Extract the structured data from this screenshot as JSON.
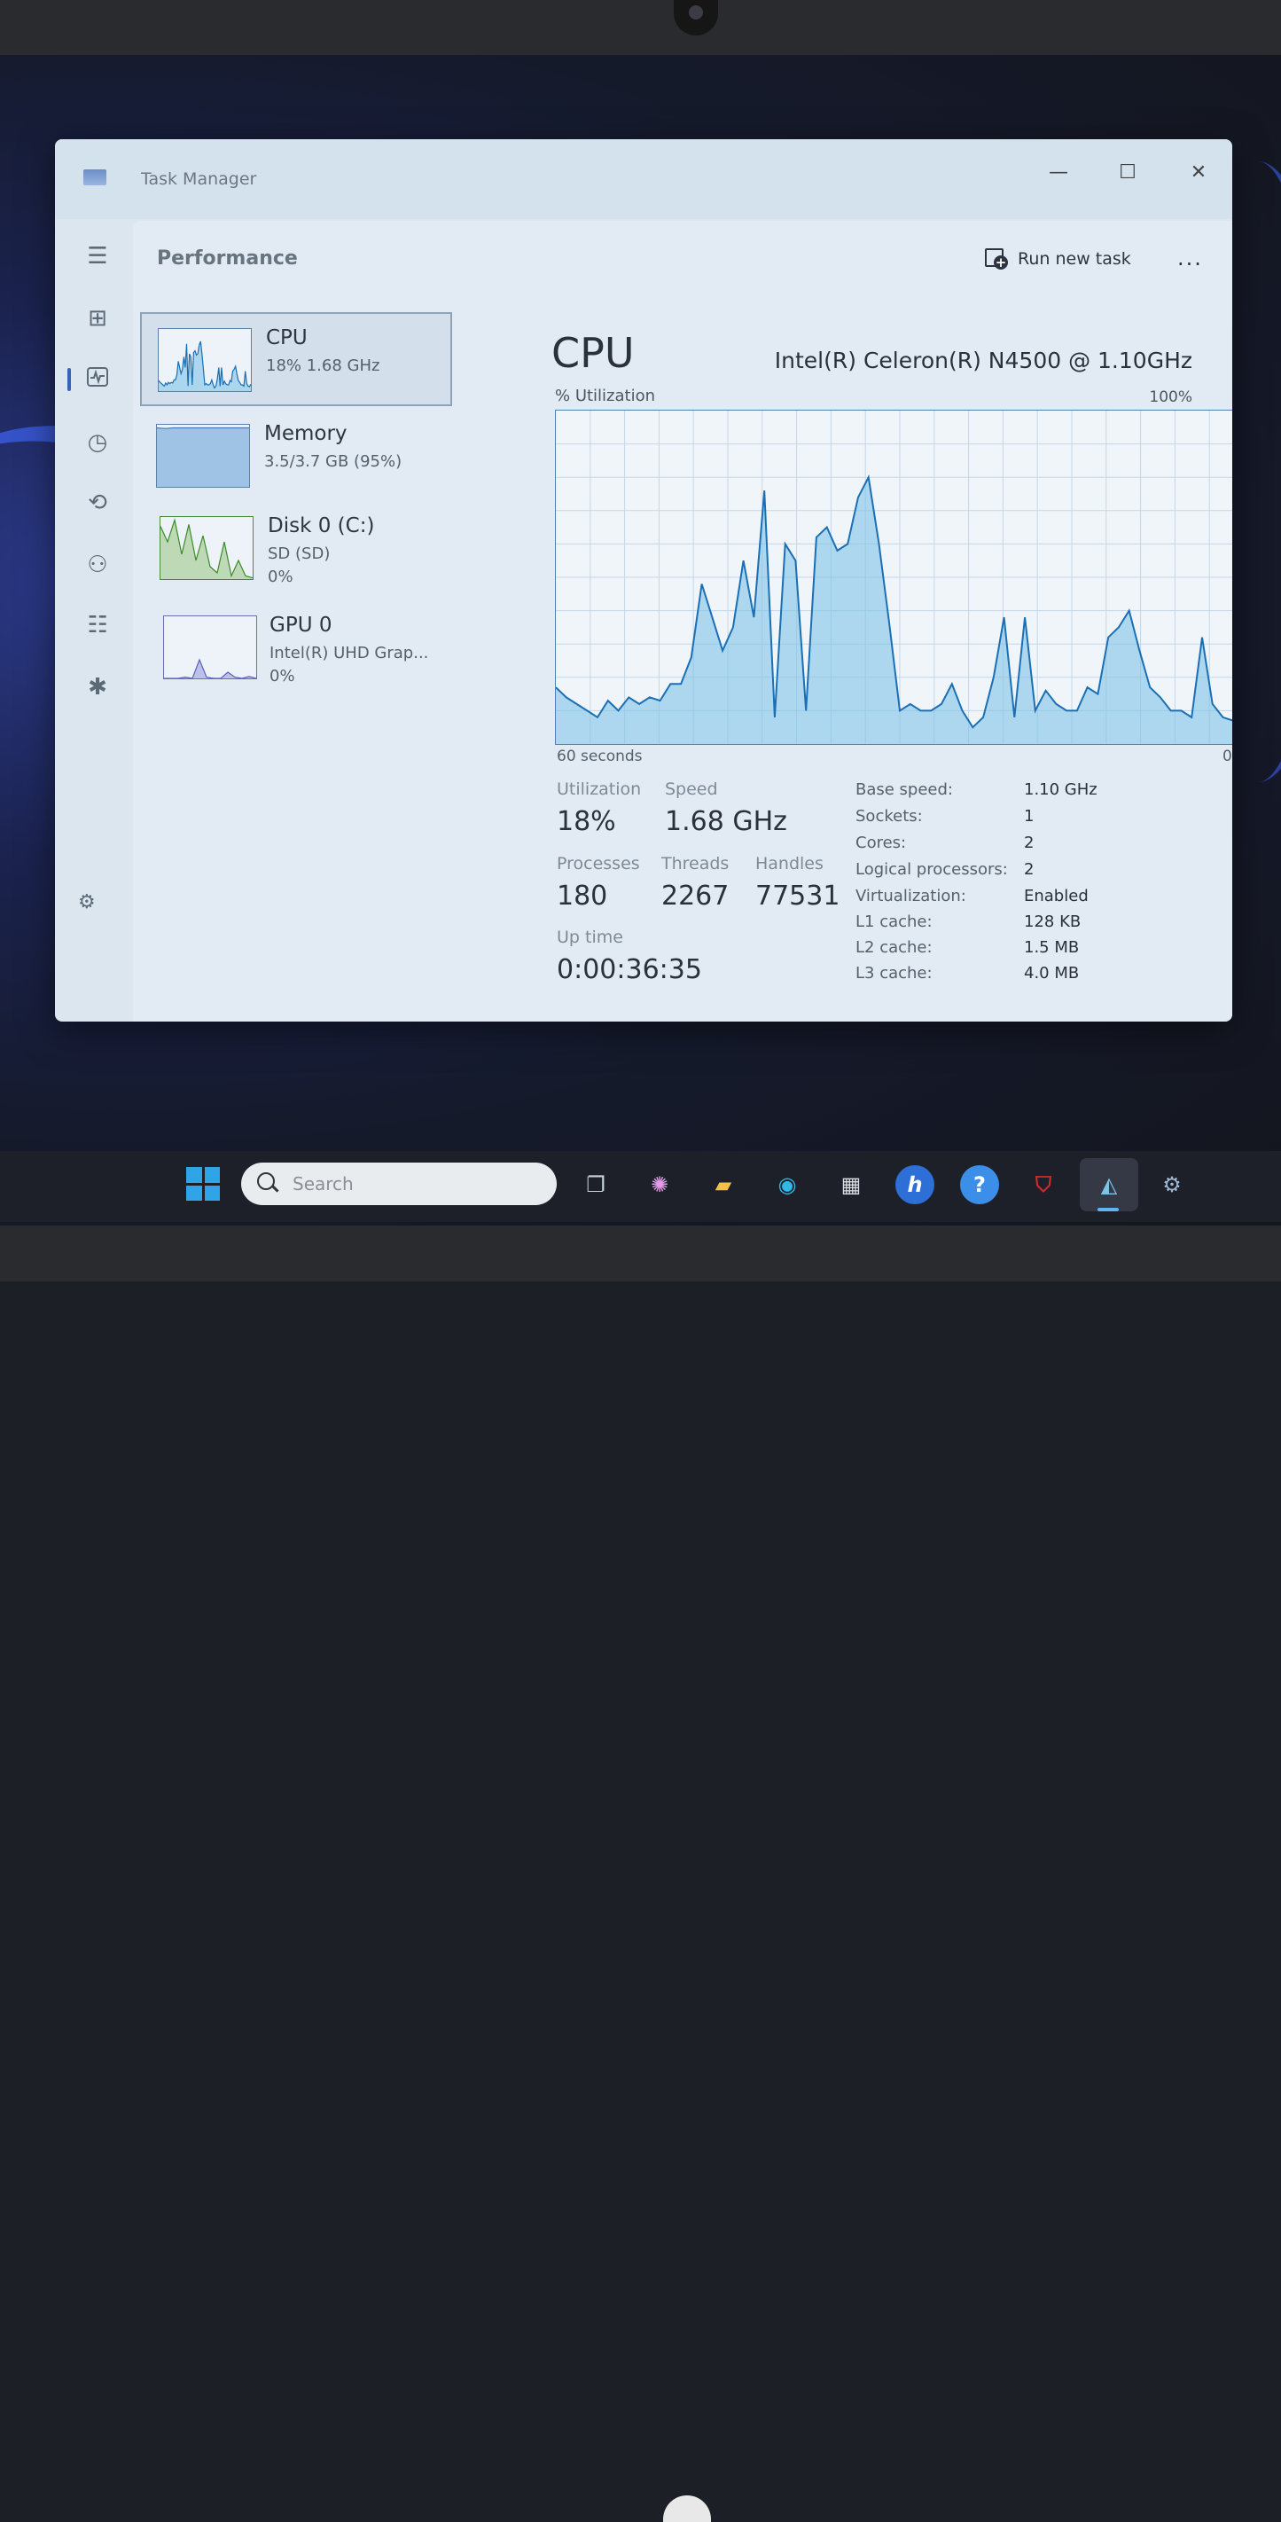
{
  "window": {
    "title": "Task Manager"
  },
  "header": {
    "page_title": "Performance",
    "run_task_label": "Run new task",
    "more_label": "..."
  },
  "devices": [
    {
      "name": "CPU",
      "line1": "18%  1.68 GHz",
      "line2": ""
    },
    {
      "name": "Memory",
      "line1": "3.5/3.7 GB (95%)",
      "line2": ""
    },
    {
      "name": "Disk 0 (C:)",
      "line1": "SD (SD)",
      "line2": "0%"
    },
    {
      "name": "GPU 0",
      "line1": "Intel(R) UHD Grap...",
      "line2": "0%"
    }
  ],
  "detail": {
    "title": "CPU",
    "model": "Intel(R) Celeron(R) N4500 @ 1.10GHz",
    "graph_label": "% Utilization",
    "graph_max": "100%",
    "graph_left": "60 seconds",
    "graph_right": "0"
  },
  "stats": {
    "utilization_label": "Utilization",
    "utilization_value": "18%",
    "speed_label": "Speed",
    "speed_value": "1.68 GHz",
    "processes_label": "Processes",
    "processes_value": "180",
    "threads_label": "Threads",
    "threads_value": "2267",
    "handles_label": "Handles",
    "handles_value": "77531",
    "uptime_label": "Up time",
    "uptime_value": "0:00:36:35"
  },
  "info": [
    {
      "label": "Base speed:",
      "value": "1.10 GHz"
    },
    {
      "label": "Sockets:",
      "value": "1"
    },
    {
      "label": "Cores:",
      "value": "2"
    },
    {
      "label": "Logical processors:",
      "value": "2"
    },
    {
      "label": "Virtualization:",
      "value": "Enabled"
    },
    {
      "label": "L1 cache:",
      "value": "128 KB"
    },
    {
      "label": "L2 cache:",
      "value": "1.5 MB"
    },
    {
      "label": "L3 cache:",
      "value": "4.0 MB"
    }
  ],
  "cpu_history_pct": [
    17,
    14,
    12,
    10,
    8,
    13,
    10,
    14,
    12,
    14,
    13,
    18,
    18,
    26,
    48,
    38,
    28,
    35,
    55,
    38,
    76,
    8,
    60,
    55,
    10,
    62,
    65,
    58,
    60,
    74,
    80,
    60,
    36,
    10,
    12,
    10,
    10,
    12,
    18,
    10,
    5,
    8,
    20,
    38,
    8,
    38,
    10,
    16,
    12,
    10,
    10,
    17,
    15,
    32,
    35,
    40,
    28,
    17,
    14,
    10,
    10,
    8,
    32,
    12,
    8,
    7,
    11
  ],
  "memory_history_pct": [
    95,
    94,
    95,
    95,
    95,
    95,
    95,
    95,
    95,
    95,
    95,
    95
  ],
  "disk_history_pct": [
    85,
    60,
    95,
    40,
    88,
    30,
    70,
    20,
    10,
    60,
    5,
    30,
    5,
    2
  ],
  "gpu_history_pct": [
    0,
    0,
    0,
    2,
    0,
    30,
    2,
    0,
    0,
    10,
    2,
    0,
    3,
    0
  ],
  "taskbar": {
    "search_placeholder": "Search"
  },
  "colors": {
    "accent": "#3a62b8",
    "graph_line": "#1a6fb5",
    "graph_fill": "#7ec3e6",
    "disk_line": "#3d8a2a",
    "taskbar": "#1d2029"
  }
}
